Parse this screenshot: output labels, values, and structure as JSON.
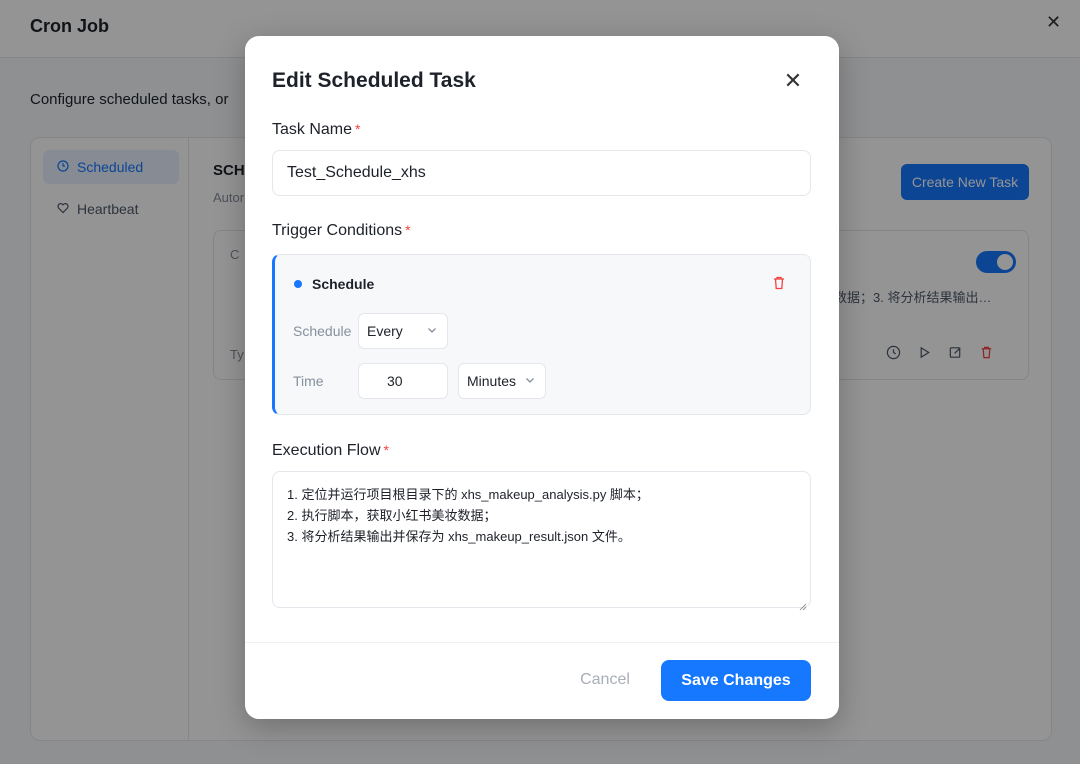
{
  "background": {
    "window_title": "Cron Job",
    "close_glyph": "✕",
    "description": "Configure scheduled tasks, or",
    "sidebar": [
      {
        "label": "Scheduled",
        "icon": "clock-icon",
        "active": true
      },
      {
        "label": "Heartbeat",
        "icon": "heart-icon",
        "active": false
      }
    ],
    "section_title": "SCH",
    "section_sub": "Autor",
    "create_button": "Create New Task",
    "card": {
      "chip": "C",
      "text": "数据；3. 将分析结果输出…",
      "type_prefix": "Ty",
      "enabled": true
    }
  },
  "modal": {
    "title": "Edit Scheduled Task",
    "close_glyph": "✕",
    "task_name": {
      "label": "Task Name",
      "required_mark": "*",
      "value": "Test_Schedule_xhs"
    },
    "trigger": {
      "label": "Trigger Conditions",
      "required_mark": "*",
      "title": "Schedule",
      "schedule_label": "Schedule",
      "schedule_value": "Every",
      "time_label": "Time",
      "time_value": "30",
      "unit_value": "Minutes"
    },
    "execution": {
      "label": "Execution Flow",
      "required_mark": "*",
      "lines": [
        "1. 定位并运行项目根目录下的 xhs_makeup_analysis.py 脚本；",
        "2. 执行脚本，获取小红书美妆数据；",
        "3. 将分析结果输出并保存为 xhs_makeup_result.json 文件。"
      ]
    },
    "cancel_label": "Cancel",
    "save_label": "Save Changes"
  },
  "colors": {
    "accent": "#1677ff",
    "danger": "#f53f3f"
  }
}
